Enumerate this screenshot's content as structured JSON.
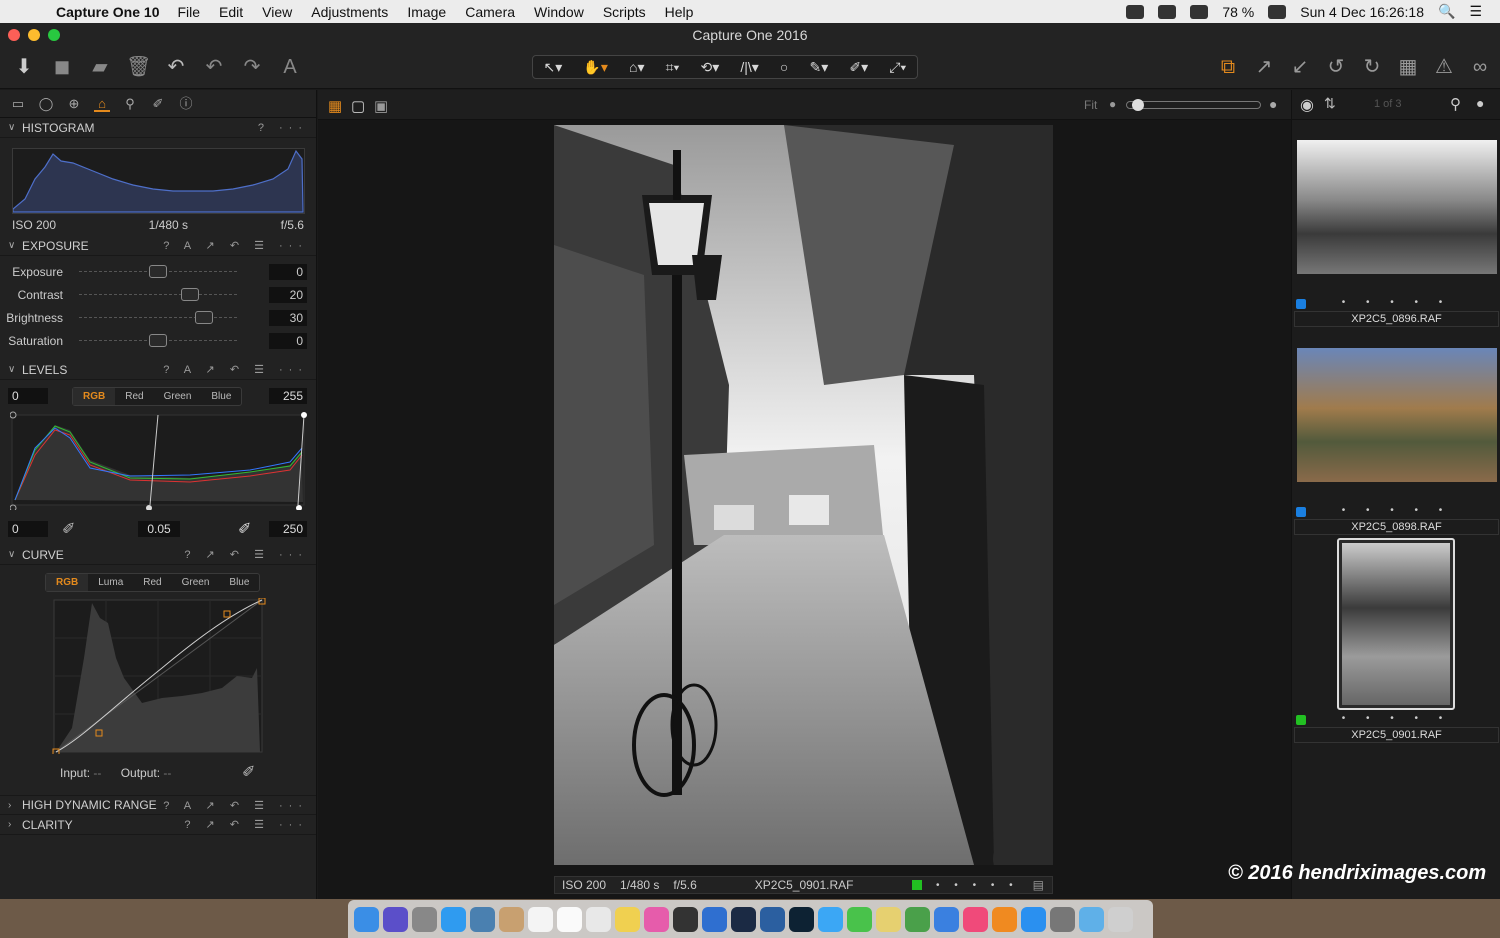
{
  "menubar": {
    "app_name": "Capture One 10",
    "items": [
      "File",
      "Edit",
      "View",
      "Adjustments",
      "Image",
      "Camera",
      "Window",
      "Scripts",
      "Help"
    ],
    "battery": "78 %",
    "clock": "Sun 4 Dec  16:26:18"
  },
  "window": {
    "title": "Capture One 2016"
  },
  "histogram": {
    "title": "HISTOGRAM",
    "iso": "ISO 200",
    "shutter": "1/480 s",
    "aperture": "f/5.6"
  },
  "exposure": {
    "title": "EXPOSURE",
    "rows": [
      {
        "label": "Exposure",
        "value": "0",
        "level": 0.5
      },
      {
        "label": "Contrast",
        "value": "20",
        "level": 0.7
      },
      {
        "label": "Brightness",
        "value": "30",
        "level": 0.79
      },
      {
        "label": "Saturation",
        "value": "0",
        "level": 0.5
      }
    ]
  },
  "levels": {
    "title": "LEVELS",
    "in_low": "0",
    "in_high": "255",
    "out_low": "0",
    "gamma": "0.05",
    "out_high": "250",
    "channels": [
      "RGB",
      "Red",
      "Green",
      "Blue"
    ]
  },
  "curve": {
    "title": "CURVE",
    "channels": [
      "RGB",
      "Luma",
      "Red",
      "Green",
      "Blue"
    ],
    "input_label": "Input:",
    "input_value": "--",
    "output_label": "Output:",
    "output_value": "--"
  },
  "collapsed_sections": [
    "HIGH DYNAMIC RANGE",
    "CLARITY"
  ],
  "viewer": {
    "fit_label": "Fit",
    "count": "1 of 3",
    "meta_iso": "ISO 200",
    "meta_shutter": "1/480 s",
    "meta_aperture": "f/5.6",
    "meta_filename": "XP2C5_0901.RAF"
  },
  "browser": {
    "items": [
      {
        "filename": "XP2C5_0896.RAF",
        "tag_color": "#1a7fe0"
      },
      {
        "filename": "XP2C5_0898.RAF",
        "tag_color": "#1a7fe0"
      },
      {
        "filename": "XP2C5_0901.RAF",
        "tag_color": "#22c022"
      }
    ],
    "rating": "• • • • •"
  },
  "watermark": "© 2016 hendriximages.com",
  "colors": {
    "accent": "#e48a1d",
    "panel": "#222222"
  }
}
